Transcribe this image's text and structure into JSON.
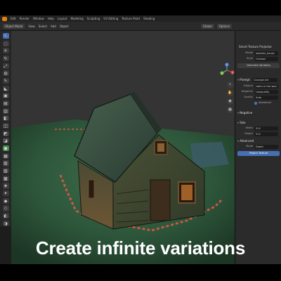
{
  "menubar": {
    "logo_icon": "blender-logo-icon",
    "items": [
      "Edit",
      "Render",
      "Window",
      "Help",
      "Layout",
      "Modeling",
      "Sculpting",
      "UV Editing",
      "Texture Paint",
      "Shading"
    ]
  },
  "header": {
    "items": [
      "Object Mode",
      "View",
      "Select",
      "Add",
      "Object"
    ],
    "right": [
      "Global",
      "Options"
    ]
  },
  "toolbar": {
    "tools": [
      "cursor-icon",
      "select-box-icon",
      "move-icon",
      "rotate-icon",
      "scale-icon",
      "transform-icon",
      "annotate-icon",
      "measure-icon",
      "add-cube-icon",
      "extrude-icon",
      "inset-icon",
      "bevel-icon",
      "loop-cut-icon",
      "knife-icon",
      "poly-build-icon",
      "spin-icon",
      "smooth-icon",
      "edge-slide-icon",
      "shrink-icon",
      "shear-icon",
      "rip-icon",
      "paint-icon",
      "fill-icon",
      "sample-icon",
      "grab-icon",
      "cloth-icon",
      "mask-icon",
      "hide-icon",
      "face-set-icon",
      "settings-icon"
    ]
  },
  "viewport": {
    "nav_icons": [
      "zoom-icon",
      "pan-icon",
      "camera-icon",
      "perspective-icon"
    ],
    "gizmo_axes": [
      "Y",
      "X",
      "Z"
    ]
  },
  "panel": {
    "title": "Smart Texture Projector",
    "rows": [
      {
        "label": "Model",
        "value": "wooden_house"
      },
      {
        "label": "Style",
        "value": "Cartoon"
      }
    ],
    "generate_label": "Generate Variation",
    "section_prompt": "Prompt",
    "prompt_value": "Concept Art",
    "subject_label": "Subject",
    "subject_value": "cabin in the woo",
    "negative_label": "Negative",
    "negative_value": "Lowquality",
    "quality_label": "Quality",
    "quality_value": "Auto",
    "checkbox_label": "Advanced",
    "section_negative": "Negative",
    "section_size": "Size",
    "width_label": "Width",
    "width_value": "512",
    "height_label": "Height",
    "height_value": "512",
    "section_advanced": "Advanced",
    "mode_label": "Mode",
    "mode_value": "Depth",
    "project_label": "Project Texture"
  },
  "caption": "Create infinite variations",
  "colors": {
    "accent": "#4670b3",
    "logo": "#e87d0d",
    "grass": "#2f5a3d",
    "highlight": "#e0584a"
  }
}
